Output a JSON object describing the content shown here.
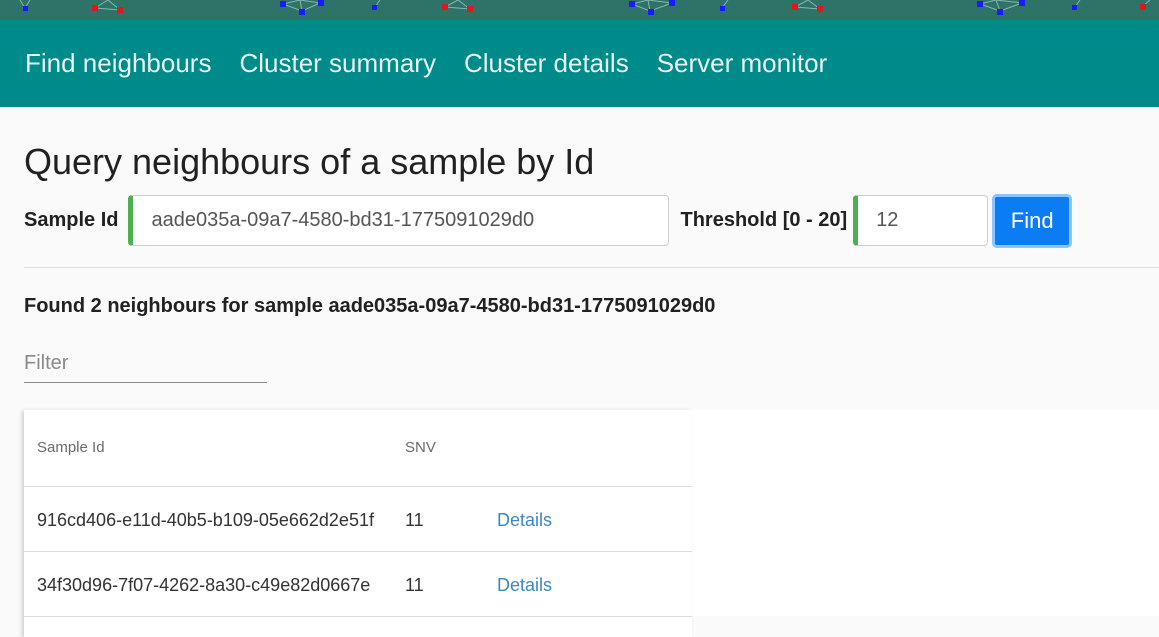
{
  "nav": {
    "items": [
      "Find neighbours",
      "Cluster summary",
      "Cluster details",
      "Server monitor"
    ]
  },
  "page": {
    "title": "Query neighbours of a sample by Id"
  },
  "query": {
    "sample_label": "Sample Id",
    "sample_value": "aade035a-09a7-4580-bd31-1775091029d0",
    "threshold_label": "Threshold [0 - 20]",
    "threshold_value": "12",
    "find_label": "Find"
  },
  "result": {
    "summary": "Found 2 neighbours for sample aade035a-09a7-4580-bd31-1775091029d0",
    "filter_placeholder": "Filter"
  },
  "table": {
    "columns": [
      "Sample Id",
      "SNV",
      ""
    ],
    "rows": [
      {
        "sample_id": "916cd406-e11d-40b5-b109-05e662d2e51f",
        "snv": "11",
        "action": "Details"
      },
      {
        "sample_id": "34f30d96-7f07-4262-8a30-c49e82d0667e",
        "snv": "11",
        "action": "Details"
      }
    ]
  },
  "colors": {
    "navbar": "#008b8b",
    "banner": "#2e7268",
    "valid_field_accent": "#4caf50",
    "primary_button": "#0a7df5",
    "link": "#3b87c7"
  }
}
